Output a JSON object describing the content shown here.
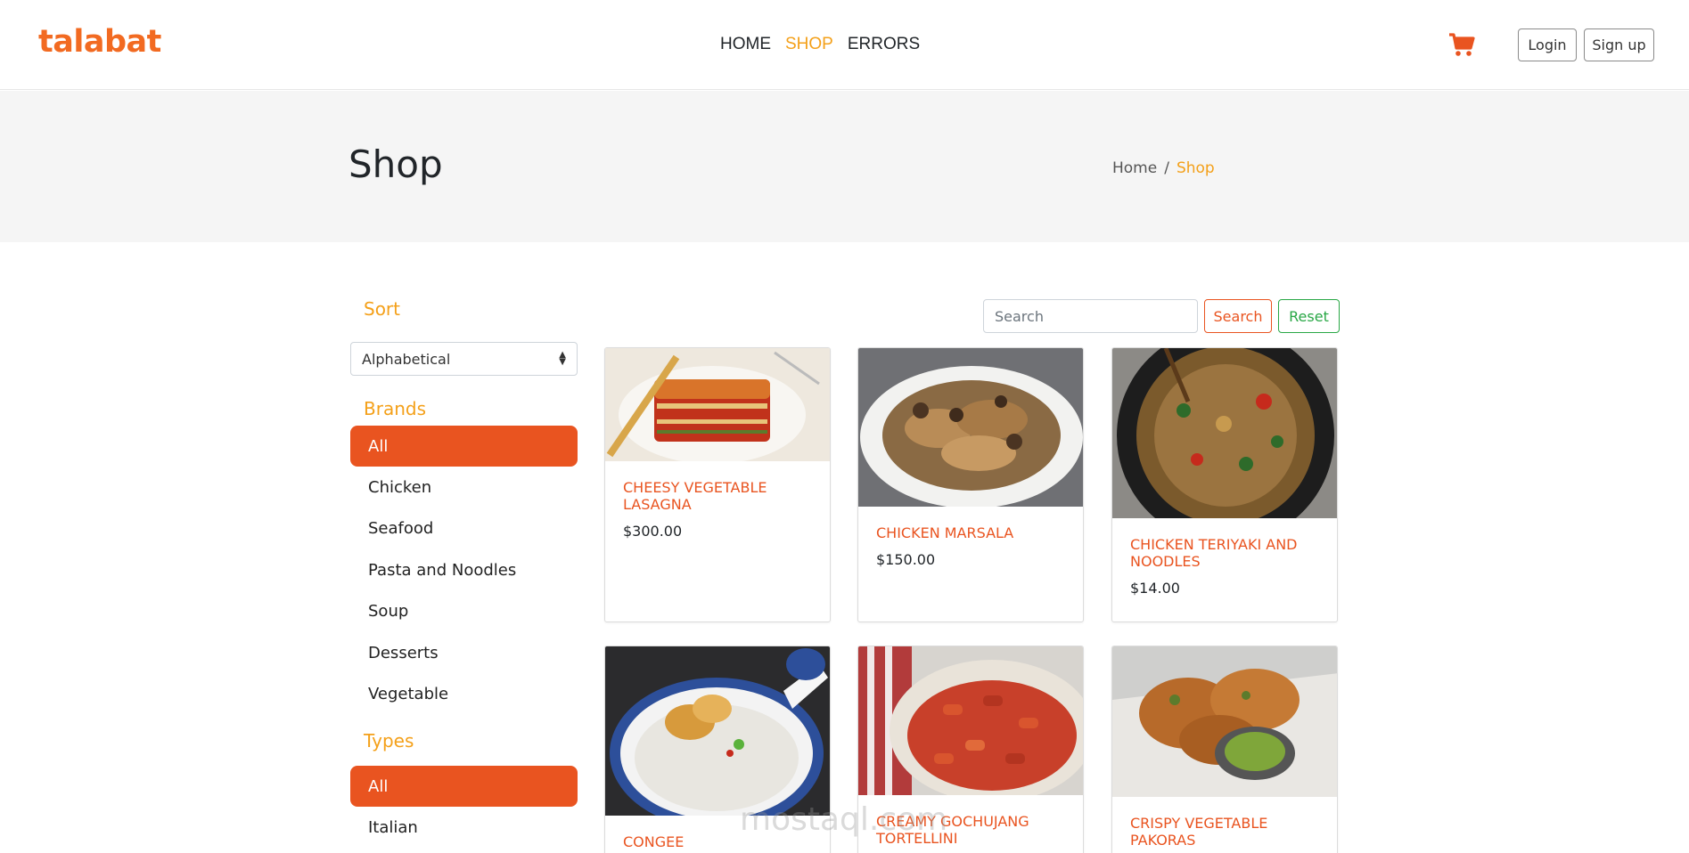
{
  "header": {
    "logo": "talabat",
    "nav": [
      {
        "label": "HOME"
      },
      {
        "label": "SHOP"
      },
      {
        "label": "ERRORS"
      }
    ],
    "cart_icon": "shopping-cart-icon",
    "login_label": "Login",
    "signup_label": "Sign up"
  },
  "banner": {
    "title": "Shop",
    "breadcrumb": {
      "home": "Home",
      "separator": "/",
      "current": "Shop"
    }
  },
  "sidebar": {
    "sort_title": "Sort",
    "sort_value": "Alphabetical",
    "brands_title": "Brands",
    "brands": [
      "All",
      "Chicken",
      "Seafood",
      "Pasta and Noodles",
      "Soup",
      "Desserts",
      "Vegetable"
    ],
    "types_title": "Types",
    "types": [
      "All",
      "Italian"
    ]
  },
  "search": {
    "placeholder": "Search",
    "search_label": "Search",
    "reset_label": "Reset"
  },
  "products": [
    {
      "name": "CHEESY VEGETABLE LASAGNA",
      "price": "$300.00"
    },
    {
      "name": "CHICKEN MARSALA",
      "price": "$150.00"
    },
    {
      "name": "CHICKEN TERIYAKI AND NOODLES",
      "price": "$14.00"
    },
    {
      "name": "CONGEE",
      "price": ""
    },
    {
      "name": "CREAMY GOCHUJANG TORTELLINI",
      "price": ""
    },
    {
      "name": "CRISPY VEGETABLE PAKORAS",
      "price": ""
    }
  ],
  "watermark": "mostaql.com",
  "colors": {
    "brand_orange": "#f26a21",
    "accent_yellow": "#f4a019",
    "primary": "#e95420",
    "reset_green": "#28a745"
  }
}
